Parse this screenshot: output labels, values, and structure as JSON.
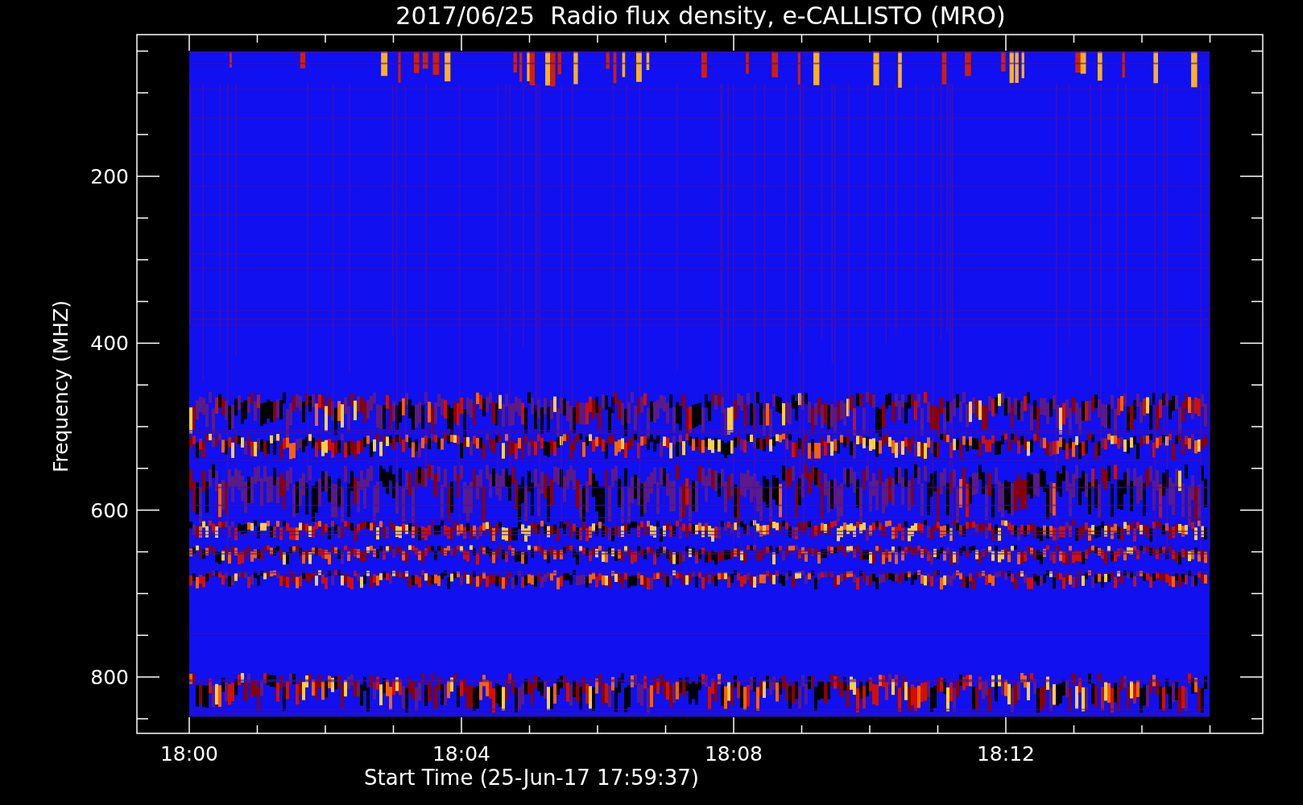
{
  "title": "2017/06/25  Radio flux density, e-CALLISTO (MRO)",
  "y_axis": {
    "label": "Frequency (MHZ)",
    "tick_labels": [
      "200",
      "400",
      "600",
      "800"
    ]
  },
  "x_axis": {
    "label": "Start Time (25-Jun-17 17:59:37)",
    "tick_labels": [
      "18:00",
      "18:04",
      "18:08",
      "18:12"
    ]
  }
}
